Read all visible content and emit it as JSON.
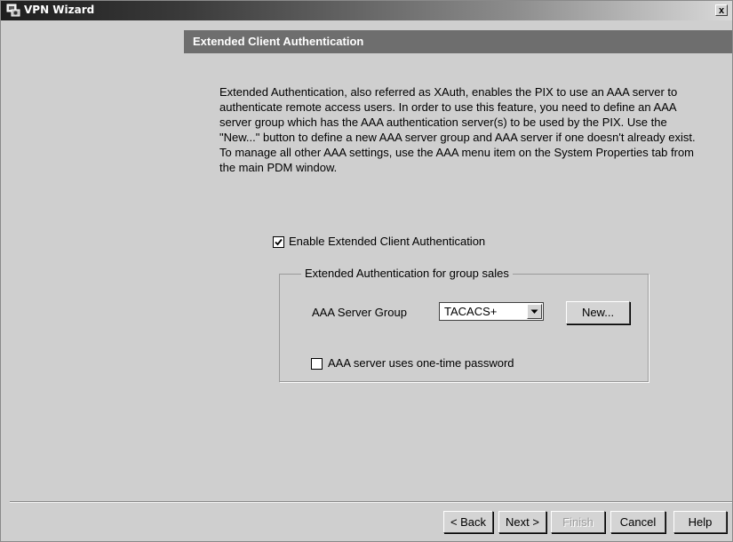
{
  "window": {
    "title": "VPN Wizard",
    "close_label": "x"
  },
  "header": {
    "title": "Extended Client Authentication"
  },
  "description": "Extended Authentication, also referred as XAuth, enables the PIX to use an AAA server to authenticate remote access users. In order to use this feature, you need to define an AAA server group which has the AAA authentication server(s) to be used by the PIX. Use the \"New...\" button to define a new AAA server group and AAA server if one doesn't already exist. To manage all other AAA settings, use the AAA menu item on the System Properties tab from the main PDM window.",
  "enable_xauth": {
    "label": "Enable Extended Client Authentication",
    "checked": true
  },
  "group": {
    "legend": "Extended Authentication for group sales",
    "server_group_label": "AAA Server Group",
    "server_group_value": "TACACS+",
    "new_button": "New...",
    "otp": {
      "label": "AAA server uses one-time password",
      "checked": false
    }
  },
  "footer": {
    "back": "< Back",
    "next": "Next >",
    "finish": "Finish",
    "cancel": "Cancel",
    "help": "Help"
  },
  "icons": {
    "app": "vpn-wizard-icon",
    "close": "close-icon",
    "dropdown": "chevron-down-icon",
    "check": "check-icon"
  }
}
